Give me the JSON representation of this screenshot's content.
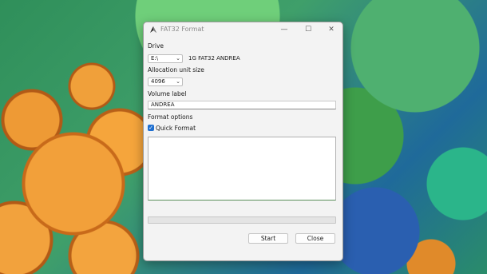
{
  "window": {
    "title": "FAT32 Format",
    "icon": "fat32-app-icon",
    "controls": {
      "minimize": "—",
      "maximize": "☐",
      "close": "✕"
    }
  },
  "drive": {
    "label": "Drive",
    "selected": "E:\\",
    "info": "1G FAT32 ANDREA"
  },
  "allocation": {
    "label": "Allocation unit size",
    "selected": "4096"
  },
  "volume": {
    "label": "Volume label",
    "value": "ANDREA"
  },
  "format_options": {
    "label": "Format options",
    "quick_format_label": "Quick Format",
    "quick_format_checked": true
  },
  "log": {
    "text": ""
  },
  "progress": {
    "percent": 0
  },
  "buttons": {
    "start": "Start",
    "close": "Close"
  },
  "colors": {
    "accent": "#1f6fd0",
    "progress": "#06b025"
  }
}
